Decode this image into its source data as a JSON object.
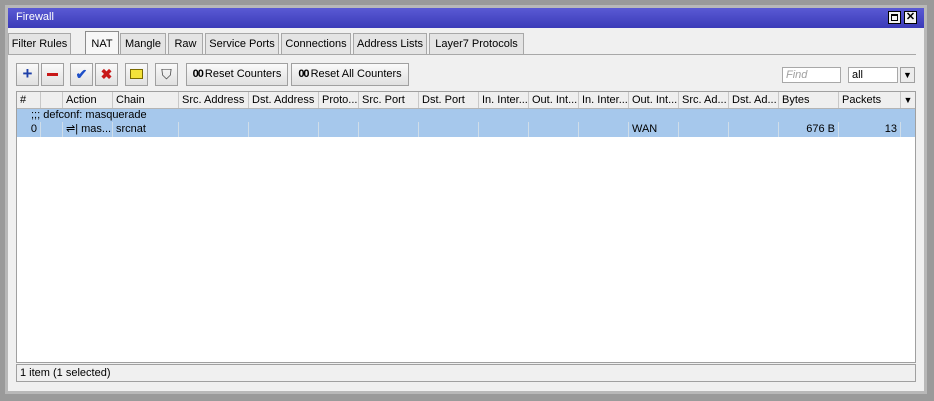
{
  "window": {
    "title": "Firewall"
  },
  "tabs": [
    {
      "label": "Filter Rules"
    },
    {
      "label": "NAT"
    },
    {
      "label": "Mangle"
    },
    {
      "label": "Raw"
    },
    {
      "label": "Service Ports"
    },
    {
      "label": "Connections"
    },
    {
      "label": "Address Lists"
    },
    {
      "label": "Layer7 Protocols"
    }
  ],
  "active_tab": "NAT",
  "toolbar": {
    "reset_counters": "Reset Counters",
    "reset_all_counters": "Reset All Counters",
    "counter_icon": "00",
    "find_placeholder": "Find",
    "filter_value": "all"
  },
  "columns": [
    "#",
    "",
    "Action",
    "Chain",
    "Src. Address",
    "Dst. Address",
    "Proto...",
    "Src. Port",
    "Dst. Port",
    "In. Inter...",
    "Out. Int...",
    "In. Inter...",
    "Out. Int...",
    "Src. Ad...",
    "Dst. Ad...",
    "Bytes",
    "Packets"
  ],
  "group": {
    "label": ";;; defconf: masquerade"
  },
  "rows": [
    {
      "num": "0",
      "action": "mas...",
      "chain": "srcnat",
      "out_interface": "WAN",
      "bytes": "676 B",
      "packets": "13"
    }
  ],
  "status": "1 item (1 selected)"
}
